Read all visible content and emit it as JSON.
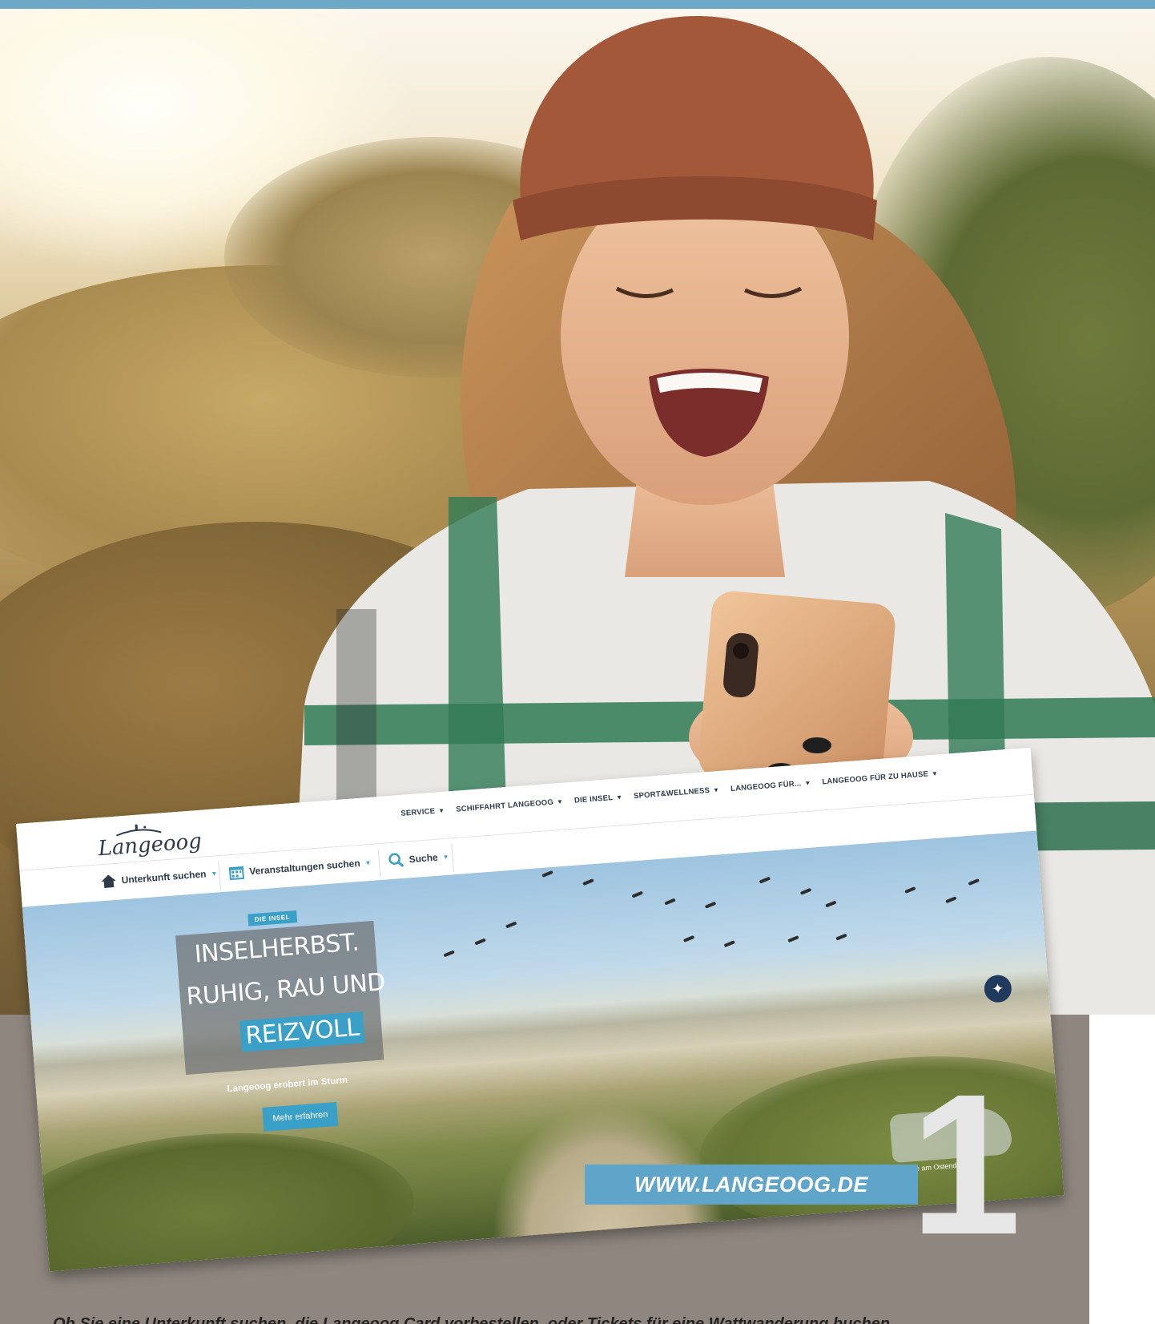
{
  "site": {
    "logo": "Langeoog",
    "nav": [
      {
        "label": "SERVICE"
      },
      {
        "label": "SCHIFFAHRT LANGEOOG"
      },
      {
        "label": "DIE INSEL"
      },
      {
        "label": "SPORT&WELLNESS"
      },
      {
        "label": "LANGEOOG FÜR..."
      },
      {
        "label": "LANGEOOG FÜR ZU HAUSE"
      }
    ],
    "subnav": [
      {
        "label": "Unterkunft suchen",
        "icon": "home-icon"
      },
      {
        "label": "Veranstaltungen suchen",
        "icon": "calendar-icon"
      },
      {
        "label": "Suche",
        "icon": "search-icon"
      }
    ],
    "hero": {
      "tag": "DIE INSEL",
      "line1": "INSELHERBST.",
      "line2": "RUHIG, RAU UND",
      "line3": "REIZVOLL",
      "subtitle": "Langeoog erobert im Sturm",
      "button": "Mehr erfahren",
      "caption": "Gänse am Ostende"
    }
  },
  "url_label": "WWW.LANGEOOG.DE",
  "number": "1",
  "bottom_text": "Ob Sie eine Unterkunft suchen, die Langeoog Card vorbestellen, oder Tickets für eine Wattwanderung buchen",
  "colors": {
    "accent": "#3aa0c8",
    "url_box": "#5fa4c9",
    "top_strip": "#6da9c7",
    "panel": "#8f877f"
  }
}
